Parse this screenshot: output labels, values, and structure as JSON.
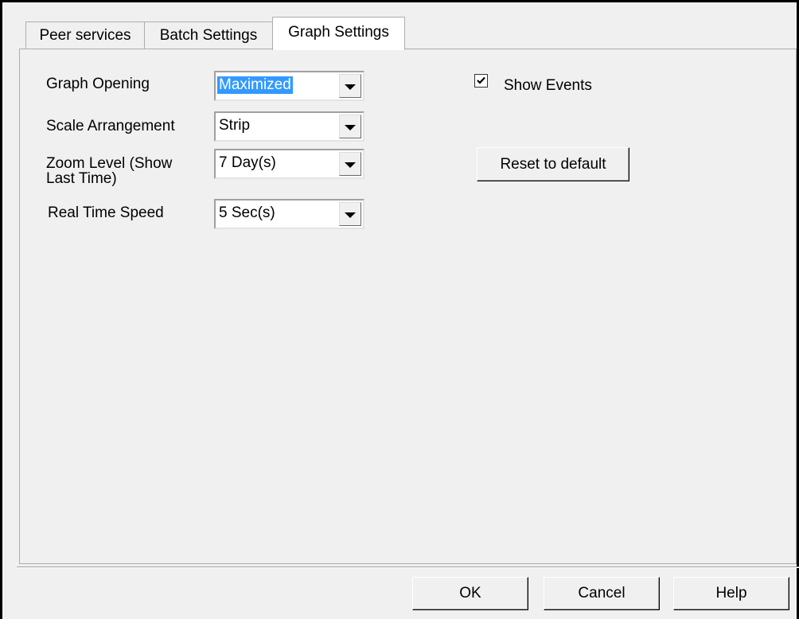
{
  "tabs": [
    "Peer services",
    "Batch Settings",
    "Graph Settings"
  ],
  "graph_settings": {
    "graph_opening_label": "Graph Opening",
    "graph_opening_value": "Maximized",
    "scale_arrangement_label": "Scale Arrangement",
    "scale_arrangement_value": "Strip",
    "zoom_level_label_line1": "Zoom Level (Show",
    "zoom_level_label_line2": "Last Time)",
    "zoom_level_value": "7 Day(s)",
    "real_time_speed_label": "Real Time Speed",
    "real_time_speed_value": "5 Sec(s)",
    "show_events_label": "Show Events",
    "show_events_checked": true,
    "reset_label": "Reset to default"
  },
  "buttons": {
    "ok": "OK",
    "cancel": "Cancel",
    "help": "Help"
  }
}
